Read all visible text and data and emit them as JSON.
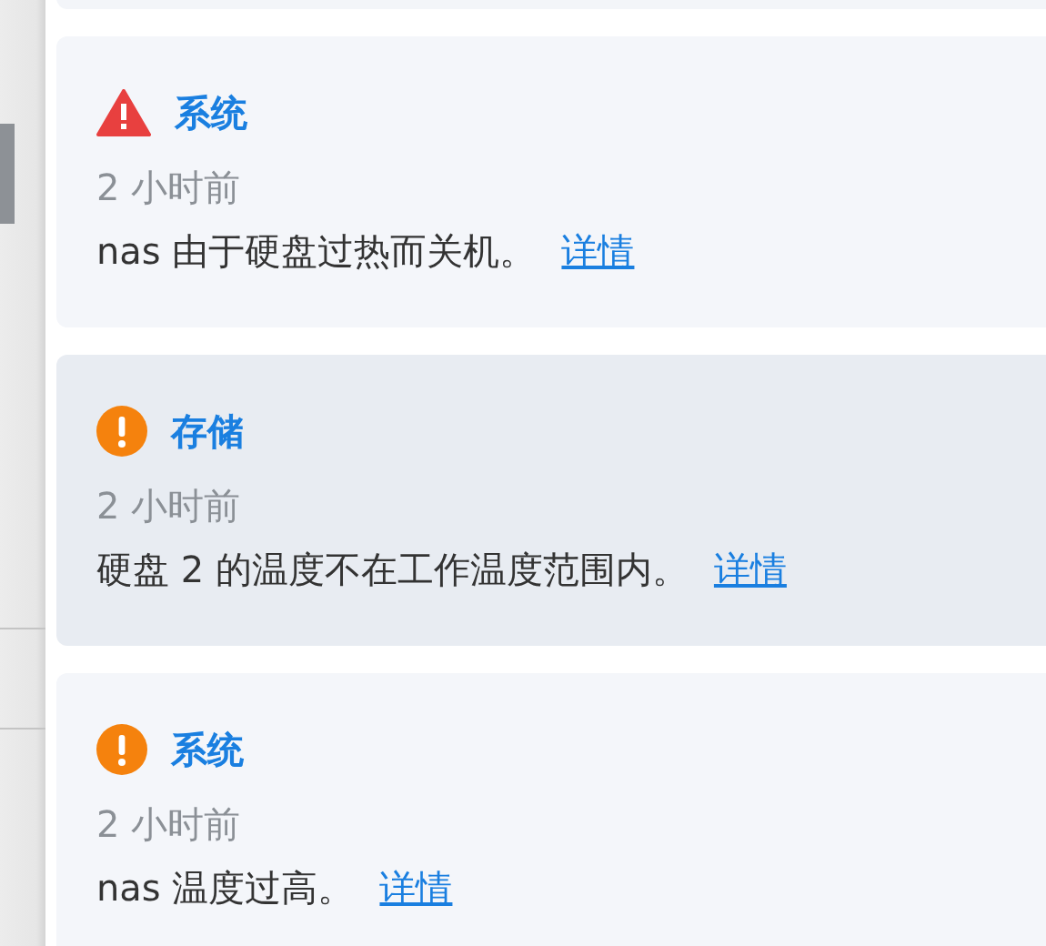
{
  "notifications": [
    {
      "kind": "error",
      "highlighted": false,
      "category": "系统",
      "time": "2 小时前",
      "message": "nas 由于硬盘过热而关机。",
      "link": "详情"
    },
    {
      "kind": "warning",
      "highlighted": true,
      "category": "存储",
      "time": "2 小时前",
      "message": "硬盘 2 的温度不在工作温度范围内。",
      "link": "详情"
    },
    {
      "kind": "warning",
      "highlighted": false,
      "category": "系统",
      "time": "2 小时前",
      "message": "nas 温度过高。",
      "link": "详情"
    }
  ]
}
